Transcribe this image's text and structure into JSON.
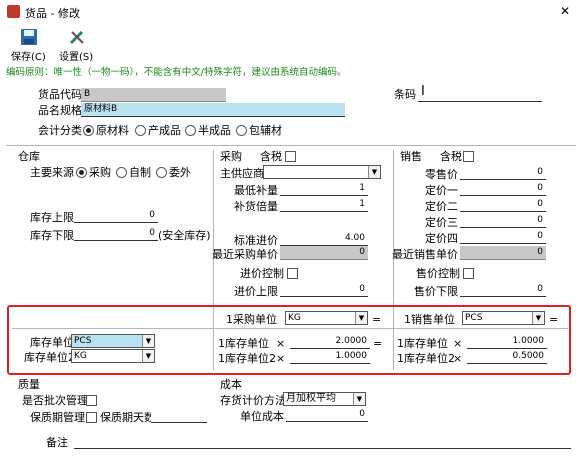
{
  "window": {
    "title": "货品 - 修改",
    "close_glyph": "✕"
  },
  "toolbar": {
    "save_label": "保存(C)",
    "settings_label": "设置(S)"
  },
  "notice": "编码原则：唯一性（一物一码），不能含有中文/特殊字符，建议由系统自动编码。",
  "basic": {
    "code_label": "货品代码",
    "code_value": "B",
    "spec_label": "品名规格",
    "spec_value": "原材料B",
    "barcode_label": "条码",
    "barcode_value": "",
    "class_label": "会计分类",
    "class_options": [
      "原材料",
      "产成品",
      "半成品",
      "包辅材"
    ],
    "class_selected": "原材料"
  },
  "warehouse": {
    "section": "仓库",
    "source_label": "主要来源",
    "source_options": [
      "采购",
      "自制",
      "委外"
    ],
    "source_selected": "采购",
    "max_label": "库存上限",
    "max_value": "0",
    "min_label": "库存下限",
    "min_value": "0",
    "min_suffix": "(安全库存)",
    "unit_label": "库存单位",
    "unit_value": "PCS",
    "unit2_label": "库存单位2",
    "unit2_value": "KG"
  },
  "purchase": {
    "section": "采购",
    "tax_label": "含税",
    "supplier_label": "主供应商",
    "supplier_value": "",
    "min_qty_label": "最低补量",
    "min_qty_value": "1",
    "multiple_label": "补货倍量",
    "multiple_value": "1",
    "std_price_label": "标准进价",
    "std_price_value": "4.00",
    "last_price_label": "最近采购单价",
    "last_price_value": "0",
    "price_ctrl_label": "进价控制",
    "price_max_label": "进价上限",
    "price_max_value": "0",
    "unit_label": "1采购单位",
    "unit_value": "KG",
    "eq": "=",
    "conv1_label": "1库存单位",
    "conv1_x": "×",
    "conv1_value": "2.0000",
    "conv1_eq": "=",
    "conv2_label": "1库存单位2",
    "conv2_x": "×",
    "conv2_value": "1.0000"
  },
  "sales": {
    "section": "销售",
    "tax_label": "含税",
    "retail_label": "零售价",
    "retail_value": "0",
    "p1_label": "定价一",
    "p1_value": "0",
    "p2_label": "定价二",
    "p2_value": "0",
    "p3_label": "定价三",
    "p3_value": "0",
    "p4_label": "定价四",
    "p4_value": "0",
    "last_label": "最近销售单价",
    "last_value": "0",
    "ctrl_label": "售价控制",
    "min_label": "售价下限",
    "min_value": "0",
    "unit_label": "1销售单位",
    "unit_value": "PCS",
    "eq": "=",
    "conv1_label": "1库存单位",
    "conv1_x": "×",
    "conv1_value": "1.0000",
    "conv2_label": "1库存单位2",
    "conv2_x": "×",
    "conv2_value": "0.5000"
  },
  "quality": {
    "section": "质量",
    "batch_label": "是否批次管理",
    "shelf_label": "保质期管理",
    "days_label": "保质期天数",
    "days_value": ""
  },
  "cost": {
    "section": "成本",
    "method_label": "存货计价方法",
    "method_value": "月加权平均",
    "unit_cost_label": "单位成本",
    "unit_cost_value": "0"
  },
  "remark": {
    "label": "备注",
    "value": ""
  },
  "colors": {
    "highlight": "#e02020",
    "cyan": "#b8e2ef",
    "gray": "#c8c8c8"
  }
}
